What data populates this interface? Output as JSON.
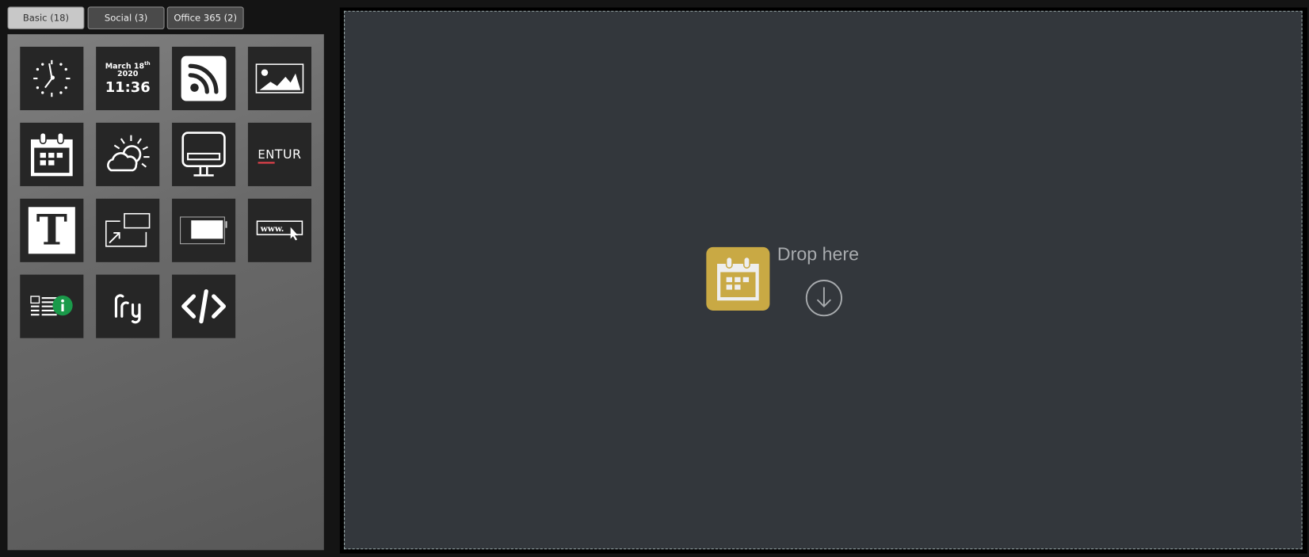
{
  "tabs": [
    {
      "label": "Basic (18)",
      "active": true
    },
    {
      "label": "Social (3)",
      "active": false
    },
    {
      "label": "Office 365 (2)",
      "active": false
    }
  ],
  "widgets": {
    "clock": "clock-icon",
    "datetime": {
      "month_day": "March 18",
      "suffix": "th",
      "year": "2020",
      "time": "11:36"
    },
    "rss": "rss-icon",
    "image": "image-icon",
    "calendar": "calendar-icon",
    "weather": "weather-icon",
    "screen": "monitor-icon",
    "entur": {
      "en": "EN",
      "tur": "TUR"
    },
    "text": "T",
    "resize": "resize-icon",
    "battery": "battery-icon",
    "web": {
      "www": "www."
    },
    "info": "news-info-icon",
    "fry": "fry",
    "code": "code-icon"
  },
  "dropzone": {
    "label": "Drop here",
    "accent": "#c9a944",
    "background": "#33373c"
  }
}
